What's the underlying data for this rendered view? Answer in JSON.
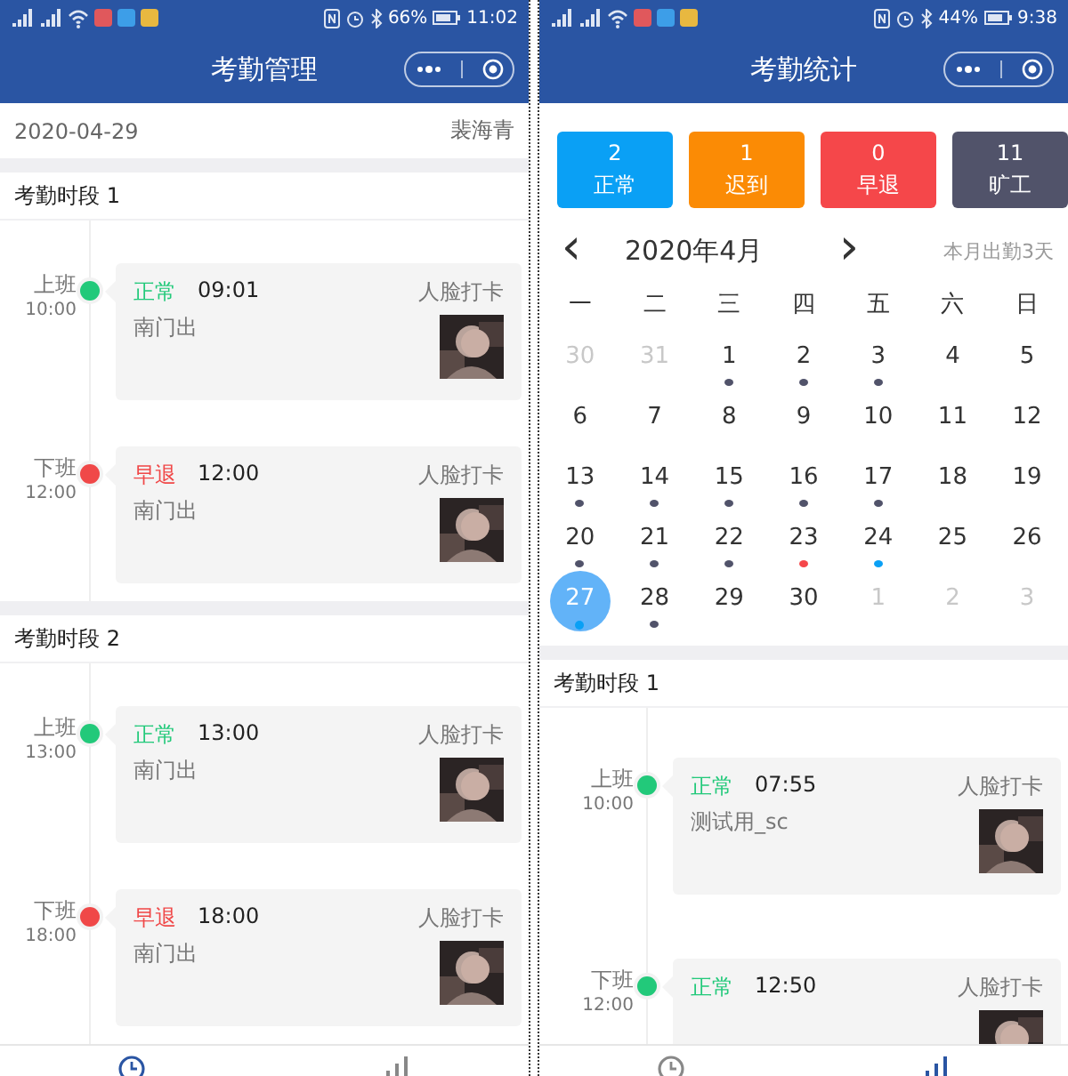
{
  "screens": [
    {
      "status_bar": {
        "battery": "66%",
        "time": "11:02"
      },
      "title": "考勤管理",
      "info": {
        "date": "2020-04-29",
        "user": "裴海青"
      },
      "sections": [
        {
          "title": "考勤时段 1",
          "records": [
            {
              "label": "上班",
              "time": "10:00",
              "status": "正常",
              "color": "#22c97a",
              "punch_time": "09:01",
              "location": "南门出",
              "method": "人脸打卡"
            },
            {
              "label": "下班",
              "time": "12:00",
              "status": "早退",
              "color": "#f04848",
              "punch_time": "12:00",
              "location": "南门出",
              "method": "人脸打卡"
            }
          ]
        },
        {
          "title": "考勤时段 2",
          "records": [
            {
              "label": "上班",
              "time": "13:00",
              "status": "正常",
              "color": "#22c97a",
              "punch_time": "13:00",
              "location": "南门出",
              "method": "人脸打卡"
            },
            {
              "label": "下班",
              "time": "18:00",
              "status": "早退",
              "color": "#f04848",
              "punch_time": "18:00",
              "location": "南门出",
              "method": "人脸打卡"
            }
          ]
        }
      ],
      "nav": [
        {
          "kind": "clock",
          "selected": true
        },
        {
          "kind": "chart",
          "selected": false
        }
      ]
    },
    {
      "status_bar": {
        "battery": "44%",
        "time": "9:38"
      },
      "title": "考勤统计",
      "stats": [
        {
          "count": "2",
          "label": "正常",
          "color": "#0aa0f5"
        },
        {
          "count": "1",
          "label": "迟到",
          "color": "#fb8b05"
        },
        {
          "count": "0",
          "label": "早退",
          "color": "#f5474a"
        },
        {
          "count": "11",
          "label": "旷工",
          "color": "#51536a"
        }
      ],
      "calendar": {
        "prev": "‹",
        "month": "2020年4月",
        "next": "›",
        "summary": "本月出勤3天",
        "weekdays": [
          "一",
          "二",
          "三",
          "四",
          "五",
          "六",
          "日"
        ],
        "days": [
          {
            "day": "30",
            "muted": true,
            "selected": false
          },
          {
            "day": "31",
            "muted": true,
            "selected": false
          },
          {
            "day": "1",
            "muted": false,
            "selected": false,
            "color": "#51536a"
          },
          {
            "day": "2",
            "muted": false,
            "selected": false,
            "color": "#51536a"
          },
          {
            "day": "3",
            "muted": false,
            "selected": false,
            "color": "#51536a"
          },
          {
            "day": "4",
            "muted": false,
            "selected": false
          },
          {
            "day": "5",
            "muted": false,
            "selected": false
          },
          {
            "day": "6",
            "muted": false,
            "selected": false
          },
          {
            "day": "7",
            "muted": false,
            "selected": false
          },
          {
            "day": "8",
            "muted": false,
            "selected": false
          },
          {
            "day": "9",
            "muted": false,
            "selected": false
          },
          {
            "day": "10",
            "muted": false,
            "selected": false
          },
          {
            "day": "11",
            "muted": false,
            "selected": false
          },
          {
            "day": "12",
            "muted": false,
            "selected": false
          },
          {
            "day": "13",
            "muted": false,
            "selected": false,
            "color": "#51536a"
          },
          {
            "day": "14",
            "muted": false,
            "selected": false,
            "color": "#51536a"
          },
          {
            "day": "15",
            "muted": false,
            "selected": false,
            "color": "#51536a"
          },
          {
            "day": "16",
            "muted": false,
            "selected": false,
            "color": "#51536a"
          },
          {
            "day": "17",
            "muted": false,
            "selected": false,
            "color": "#51536a"
          },
          {
            "day": "18",
            "muted": false,
            "selected": false
          },
          {
            "day": "19",
            "muted": false,
            "selected": false
          },
          {
            "day": "20",
            "muted": false,
            "selected": false,
            "color": "#51536a"
          },
          {
            "day": "21",
            "muted": false,
            "selected": false,
            "color": "#51536a"
          },
          {
            "day": "22",
            "muted": false,
            "selected": false,
            "color": "#51536a"
          },
          {
            "day": "23",
            "muted": false,
            "selected": false,
            "color": "#f5474a"
          },
          {
            "day": "24",
            "muted": false,
            "selected": false,
            "color": "#0aa0f5"
          },
          {
            "day": "25",
            "muted": false,
            "selected": false
          },
          {
            "day": "26",
            "muted": false,
            "selected": false
          },
          {
            "day": "27",
            "muted": false,
            "selected": true,
            "color": "#0aa0f5"
          },
          {
            "day": "28",
            "muted": false,
            "selected": false,
            "color": "#51536a"
          },
          {
            "day": "29",
            "muted": false,
            "selected": false
          },
          {
            "day": "30",
            "muted": false,
            "selected": false
          },
          {
            "day": "1",
            "muted": true,
            "selected": false
          },
          {
            "day": "2",
            "muted": true,
            "selected": false
          },
          {
            "day": "3",
            "muted": true,
            "selected": false
          }
        ]
      },
      "sections": [
        {
          "title": "考勤时段 1",
          "records": [
            {
              "label": "上班",
              "time": "10:00",
              "status": "正常",
              "color": "#22c97a",
              "punch_time": "07:55",
              "location": "测试用_sc",
              "method": "人脸打卡"
            },
            {
              "label": "下班",
              "time": "12:00",
              "status": "正常",
              "color": "#22c97a",
              "punch_time": "12:50",
              "method": "人脸打卡"
            }
          ]
        }
      ],
      "nav": [
        {
          "kind": "clock",
          "selected": false
        },
        {
          "kind": "chart",
          "selected": true
        }
      ]
    }
  ]
}
